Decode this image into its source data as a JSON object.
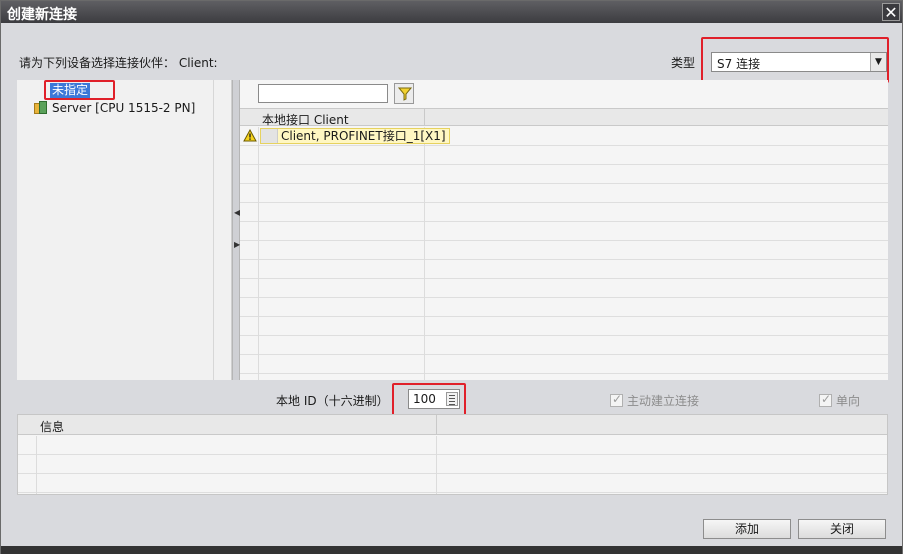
{
  "window": {
    "title": "创建新连接",
    "close_glyph": "✕"
  },
  "prompt": {
    "text": "请为下列设备选择连接伙伴： Client:"
  },
  "connection_type": {
    "label": "类型",
    "value": "S7 连接",
    "arrow": "▼"
  },
  "tree": {
    "items": [
      {
        "label": "未指定",
        "selected": true
      },
      {
        "label": "Server [CPU 1515-2 PN]",
        "icon": "plc-station-icon"
      }
    ]
  },
  "interface_grid": {
    "header_col1": "本地接口 Client",
    "rows": [
      {
        "status_icon": "warning-icon",
        "value": "Client, PROFINET接口_1[X1]"
      }
    ]
  },
  "local_id": {
    "label": "本地 ID（十六进制）",
    "value": "100"
  },
  "options": {
    "active_connect": {
      "label": "主动建立连接",
      "checked": true,
      "enabled": false
    },
    "one_way": {
      "label": "单向",
      "checked": true,
      "enabled": false
    }
  },
  "info_grid": {
    "header": "信息"
  },
  "buttons": {
    "add": "添加",
    "close": "关闭"
  },
  "colors": {
    "highlight": "#e0202a",
    "selection": "#3c78d8",
    "warning_bg": "#fff7c2"
  }
}
